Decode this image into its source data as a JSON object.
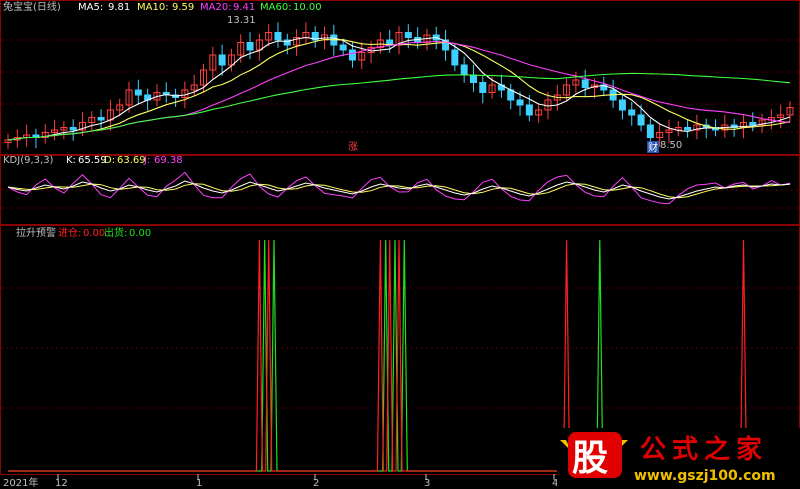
{
  "colors": {
    "background": "#000000",
    "frame": "#8b0000",
    "grid": "#5a0000",
    "label": "#c0c0c0",
    "up": "#ff4040",
    "down": "#40d0ff",
    "ma5": "#ffffff",
    "ma10": "#ffff60",
    "ma20": "#ff40ff",
    "ma60": "#40ff40",
    "enter": "#ff2020",
    "exit": "#20e020",
    "kdj_k": "#ffffff",
    "kdj_d": "#ffff60",
    "kdj_j": "#ff40ff",
    "logo_red": "#e00000",
    "logo_gold": "#f0c000"
  },
  "header": {
    "stock_name": "兔宝宝(日线)",
    "ma5_label": "MA5:",
    "ma5_value": "9.81",
    "ma10_label": "MA10:",
    "ma10_value": "9.59",
    "ma20_label": "MA20:",
    "ma20_value": "9.41",
    "ma60_label": "MA60:",
    "ma60_value": "10.00"
  },
  "kdj_header": {
    "label": "KDJ(9,3,3)",
    "k_label": "K:",
    "k_value": "65.59",
    "d_label": "D:",
    "d_value": "63.69",
    "j_label": "J:",
    "j_value": "69.38"
  },
  "signal_header": {
    "label": "拉升预警",
    "enter_label": "进仓:",
    "enter_value": "0.00",
    "exit_label": "出货:",
    "exit_value": "0.00"
  },
  "annotations": {
    "high_price": "13.31",
    "low_price": "8.50",
    "zhang_marker": "涨",
    "cai_marker": "财"
  },
  "x_axis": {
    "labels": [
      "2021年",
      "12",
      "1",
      "2",
      "3",
      "4"
    ]
  },
  "watermark": {
    "big_char": "股",
    "title": "公式之家",
    "url": "www.gszj100.com"
  },
  "chart_data": [
    {
      "type": "candlestick",
      "title": "兔宝宝(日线)",
      "series": [
        {
          "name": "MA5",
          "value": 9.81
        },
        {
          "name": "MA10",
          "value": 9.59
        },
        {
          "name": "MA20",
          "value": 9.41
        },
        {
          "name": "MA60",
          "value": 10.0
        }
      ],
      "high": 13.31,
      "low": 8.5,
      "ylim": [
        8.2,
        13.6
      ],
      "close": [
        8.6,
        8.7,
        8.8,
        8.7,
        8.9,
        9.0,
        9.1,
        9.0,
        9.3,
        9.5,
        9.4,
        9.8,
        10.0,
        10.6,
        10.4,
        10.2,
        10.5,
        10.4,
        10.3,
        10.6,
        10.8,
        11.4,
        12.0,
        11.6,
        12.0,
        12.5,
        12.2,
        12.6,
        12.9,
        12.6,
        12.4,
        12.7,
        12.9,
        12.6,
        12.8,
        12.4,
        12.2,
        11.8,
        12.1,
        12.3,
        12.6,
        12.4,
        12.9,
        12.7,
        12.5,
        12.8,
        12.6,
        12.2,
        11.6,
        11.2,
        10.9,
        10.5,
        10.8,
        10.6,
        10.2,
        10.0,
        9.6,
        9.8,
        10.2,
        10.4,
        10.8,
        11.0,
        10.7,
        10.8,
        10.6,
        10.2,
        9.8,
        9.6,
        9.2,
        8.7,
        8.9,
        9.0,
        9.1,
        9.0,
        9.2,
        9.1,
        9.0,
        9.2,
        9.1,
        9.3,
        9.2,
        9.4,
        9.5,
        9.6,
        9.9
      ]
    },
    {
      "type": "line",
      "title": "KDJ(9,3,3)",
      "series": [
        {
          "name": "K",
          "value": 65.59
        },
        {
          "name": "D",
          "value": 63.69
        },
        {
          "name": "J",
          "value": 69.38
        }
      ],
      "ylim": [
        -10,
        110
      ],
      "k": [
        60,
        55,
        52,
        58,
        64,
        60,
        56,
        62,
        70,
        66,
        58,
        52,
        56,
        64,
        60,
        54,
        50,
        56,
        62,
        72,
        66,
        58,
        52,
        48,
        54,
        62,
        70,
        64,
        58,
        52,
        56,
        62,
        68,
        64,
        58,
        54,
        50,
        46,
        52,
        60,
        66,
        62,
        58,
        56,
        62,
        66,
        60,
        54,
        48,
        44,
        48,
        56,
        62,
        58,
        52,
        46,
        42,
        48,
        56,
        64,
        70,
        66,
        60,
        54,
        50,
        56,
        64,
        60,
        52,
        46,
        40,
        36,
        40,
        46,
        52,
        56,
        60,
        58,
        62,
        64,
        60,
        62,
        66,
        64,
        66
      ],
      "enter_signals": [
        0,
        0,
        0,
        0,
        0,
        0,
        0,
        0,
        0,
        0,
        0,
        0,
        0,
        0,
        0,
        0,
        0,
        0,
        0,
        0,
        0,
        0,
        0,
        0,
        0,
        0,
        0,
        1,
        1,
        0,
        0,
        0,
        0,
        0,
        0,
        0,
        0,
        0,
        0,
        0,
        1,
        1,
        1,
        0,
        0,
        0,
        0,
        0,
        0,
        0,
        0,
        0,
        0,
        0,
        0,
        0,
        0,
        0,
        0,
        0,
        1,
        0,
        0,
        0,
        0,
        0,
        0,
        0,
        0,
        0,
        0,
        0,
        0,
        0,
        0,
        0,
        0,
        0,
        0,
        1,
        0,
        0,
        0,
        0,
        0
      ],
      "exit_signals": [
        0,
        0,
        0,
        0,
        0,
        0,
        0,
        0,
        0,
        0,
        0,
        0,
        0,
        0,
        0,
        0,
        0,
        0,
        0,
        0,
        0,
        0,
        0,
        0,
        0,
        0,
        0,
        0,
        1,
        1,
        0,
        0,
        0,
        0,
        0,
        0,
        0,
        0,
        0,
        0,
        0,
        1,
        1,
        1,
        0,
        0,
        0,
        0,
        0,
        0,
        0,
        0,
        0,
        0,
        0,
        0,
        0,
        0,
        0,
        0,
        0,
        0,
        0,
        0,
        1,
        0,
        0,
        0,
        0,
        0,
        0,
        0,
        0,
        0,
        0,
        0,
        0,
        0,
        0,
        0,
        0,
        0,
        0,
        0,
        0
      ]
    }
  ]
}
